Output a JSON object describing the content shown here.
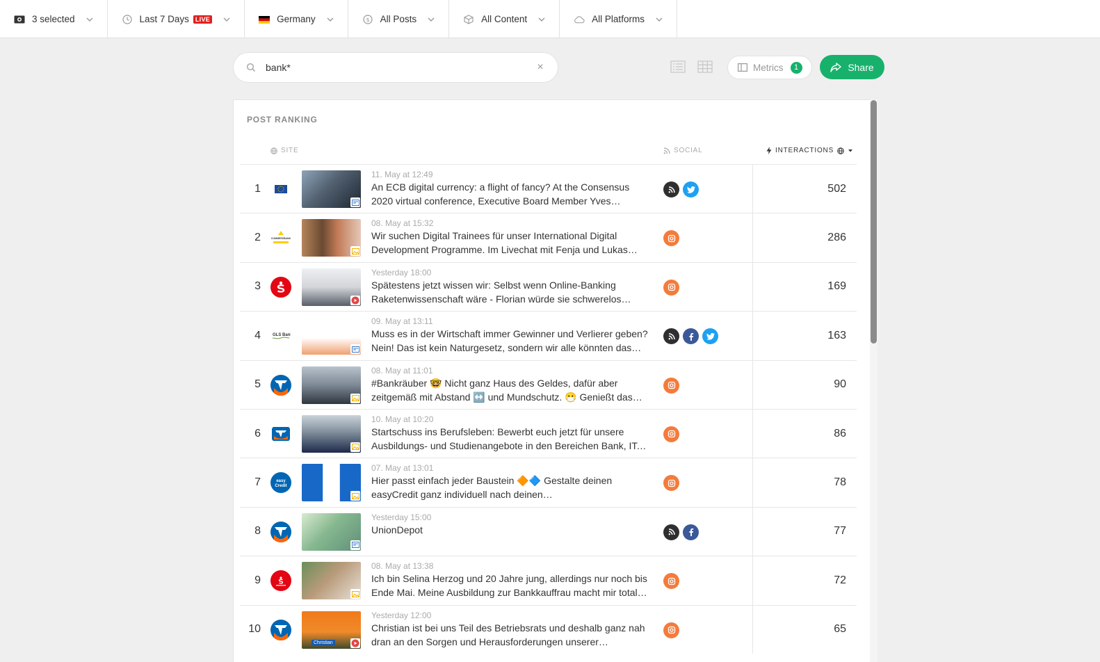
{
  "filters": [
    {
      "label": "3 selected",
      "icon": "money-icon"
    },
    {
      "label": "Last 7 Days",
      "icon": "clock-icon",
      "badge": "LIVE"
    },
    {
      "label": "Germany",
      "icon": "flag-germany-icon"
    },
    {
      "label": "All Posts",
      "icon": "dollar-circle-icon"
    },
    {
      "label": "All Content",
      "icon": "cube-icon"
    },
    {
      "label": "All Platforms",
      "icon": "cloud-icon"
    }
  ],
  "search": {
    "value": "bank*",
    "placeholder": ""
  },
  "toolbar": {
    "metrics_label": "Metrics",
    "metrics_count": "1",
    "share_label": "Share"
  },
  "ranking": {
    "title": "POST RANKING",
    "columns": {
      "site": "SITE",
      "social": "SOCIAL",
      "interactions": "INTERACTIONS"
    },
    "rows": [
      {
        "rank": "1",
        "date": "11. May at 12:49",
        "text": "An ECB digital currency: a flight of fancy? At the Consensus 2020 virtual conference, Executive Board Member Yves Mersc…",
        "socials": [
          "rss",
          "tw"
        ],
        "value": "502",
        "content_type": "link",
        "logo": "ecb"
      },
      {
        "rank": "2",
        "date": "08. May at 15:32",
        "text": "Wir suchen Digital Trainees für unser International Digital Development Programme. Im Livechat mit Fenja und Lukas…",
        "socials": [
          "ig"
        ],
        "value": "286",
        "content_type": "image",
        "logo": "commerzbank"
      },
      {
        "rank": "3",
        "date": "Yesterday 18:00",
        "text": "Spätestens jetzt wissen wir: Selbst wenn Online-Banking Raketenwissenschaft wäre - Florian würde sie schwerelos…",
        "socials": [
          "ig"
        ],
        "value": "169",
        "content_type": "video",
        "logo": "sparkasse"
      },
      {
        "rank": "4",
        "date": "09. May at 13:11",
        "text": "Muss es in der Wirtschaft immer Gewinner und Verlierer geben? Nein! Das ist kein Naturgesetz, sondern wir alle könnten das…",
        "socials": [
          "rss",
          "fb",
          "tw"
        ],
        "value": "163",
        "content_type": "link",
        "logo": "gls"
      },
      {
        "rank": "5",
        "date": "08. May at 11:01",
        "text": "#Bankräuber 🤓 Nicht ganz Haus des Geldes, dafür aber zeitgemäß mit Abstand ↔️ und Mundschutz. 😷 Genießt das…",
        "socials": [
          "ig"
        ],
        "value": "90",
        "content_type": "image",
        "logo": "volksbank"
      },
      {
        "rank": "6",
        "date": "10. May at 10:20",
        "text": "Startschuss ins Berufsleben: Bewerbt euch jetzt für unsere Ausbildungs- und Studienangebote in den Bereichen Bank, IT, E…",
        "socials": [
          "ig"
        ],
        "value": "86",
        "content_type": "image",
        "logo": "volksbank-square"
      },
      {
        "rank": "7",
        "date": "07. May at 13:01",
        "text": "Hier passt einfach jeder Baustein 🔶🔷 Gestalte deinen easyCredit ganz individuell nach deinen…",
        "socials": [
          "ig"
        ],
        "value": "78",
        "content_type": "image",
        "logo": "easycredit"
      },
      {
        "rank": "8",
        "date": "Yesterday 15:00",
        "text": "UnionDepot",
        "socials": [
          "rss",
          "fb"
        ],
        "value": "77",
        "content_type": "link",
        "logo": "volksbank"
      },
      {
        "rank": "9",
        "date": "08. May at 13:38",
        "text": "Ich bin Selina Herzog und 20 Jahre jung, allerdings nur noch bis Ende Mai. Meine Ausbildung zur Bankkauffrau macht mir total…",
        "socials": [
          "ig"
        ],
        "value": "72",
        "content_type": "image",
        "logo": "sparkasse-small"
      },
      {
        "rank": "10",
        "date": "Yesterday 12:00",
        "text": "Christian ist bei uns Teil des Betriebsrats und deshalb ganz nah dran an den Sorgen und Herausforderungen unserer…",
        "socials": [
          "ig"
        ],
        "value": "65",
        "content_type": "video",
        "logo": "volksbank",
        "thumb_caption": "Christian"
      }
    ]
  },
  "colors": {
    "accent": "#18b16c",
    "live": "#e0211f",
    "instagram": "#f47b3c",
    "facebook": "#3b5998",
    "twitter": "#1da1f2",
    "rss": "#2f2f2f"
  }
}
